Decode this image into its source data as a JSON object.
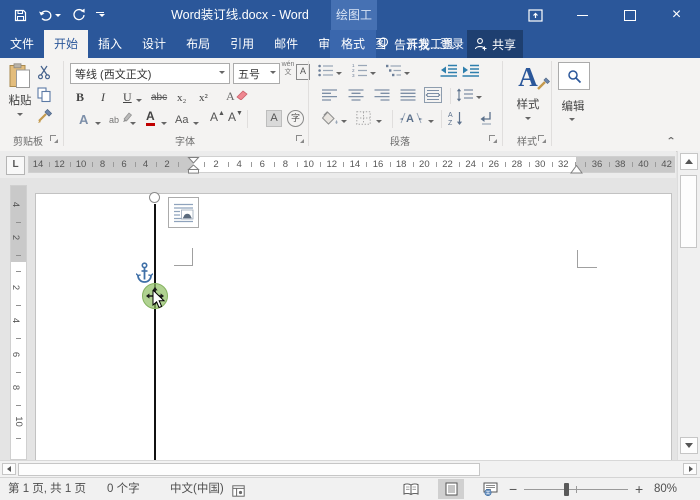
{
  "colors": {
    "titlebar": "#2b579a",
    "contextual_group_bg": "#4671b3",
    "format_tab_bg": "#3a67ad",
    "share_bg": "#1e3f70",
    "ribbon_bg": "#f4f3f2",
    "active_tab_text": "#2b579a",
    "green_handle": "#92c167",
    "font_color_red": "#c00000"
  },
  "titlebar": {
    "title": "Word装订线.docx - Word",
    "contextual_group": "绘图工具"
  },
  "icons": {
    "save": "floppy",
    "undo": "curved-left-arrow",
    "repeat": "circular-arrow",
    "qat-customize": "bar+caret",
    "ribbon-display": "box-caret",
    "minimize": "—",
    "maximize": "□",
    "close": "×",
    "tell-me": "lightbulb",
    "share": "person-plus",
    "paste": "clipboard",
    "cut": "scissors",
    "copy": "two-pages",
    "format-painter": "brush",
    "clear-format": "eraser",
    "search": "magnifier",
    "read-mode": "book",
    "print-layout": "page",
    "web-layout": "page-globe",
    "macro": "window-grid",
    "anchor": "anchor",
    "move": "four-arrows",
    "cursor": "arrow-pointer",
    "layout-options": "lines-arch"
  },
  "tabs": {
    "file": "文件",
    "main": [
      "开始",
      "插入",
      "设计",
      "布局",
      "引用",
      "邮件",
      "审阅",
      "视图",
      "开发工具"
    ],
    "active_index": 0,
    "contextual": "格式",
    "tell_me": "告诉我...",
    "sign_in": "登录",
    "share": "共享"
  },
  "ribbon": {
    "clipboard": {
      "paste": "粘贴",
      "group_label": "剪贴板"
    },
    "font": {
      "name": "等线 (西文正文)",
      "size": "五号",
      "phonetic_top": "wén",
      "phonetic_bottom": "文",
      "char_border": "A",
      "bold": "B",
      "italic": "I",
      "underline": "U",
      "strikethrough": "abc",
      "subscript": "x₂",
      "superscript": "x²",
      "clear_format": "A",
      "text_effects": "A",
      "highlight": "ab",
      "font_color": "A",
      "change_case": "Aa",
      "grow_font": "A",
      "shrink_font": "A",
      "char_shading": "A",
      "enclose_char": "字",
      "group_label": "字体"
    },
    "paragraph": {
      "sort_a": "A",
      "sort_z": "Z",
      "asian_layout": "A",
      "group_label": "段落"
    },
    "styles": {
      "button": "样式",
      "group_label": "样式"
    },
    "editing": {
      "button": "编辑"
    }
  },
  "ruler": {
    "left_margin_numbers": [
      "14",
      "12",
      "10",
      "8",
      "6",
      "4",
      "2"
    ],
    "body_numbers": [
      "2",
      "4",
      "6",
      "8",
      "10",
      "12",
      "14",
      "16",
      "18",
      "20",
      "22",
      "24",
      "26",
      "28",
      "30",
      "32"
    ],
    "right_margin_numbers": [
      "36",
      "38",
      "40",
      "42"
    ],
    "tab_selector": "L",
    "v_margin_numbers": [
      "4",
      "2"
    ],
    "v_body_numbers": [
      "2",
      "4",
      "6",
      "8",
      "10"
    ]
  },
  "statusbar": {
    "page_info": "第 1 页, 共 1 页",
    "word_count": "0 个字",
    "language": "中文(中国)",
    "zoom": "80%",
    "zoom_minus": "−",
    "zoom_plus": "+"
  }
}
